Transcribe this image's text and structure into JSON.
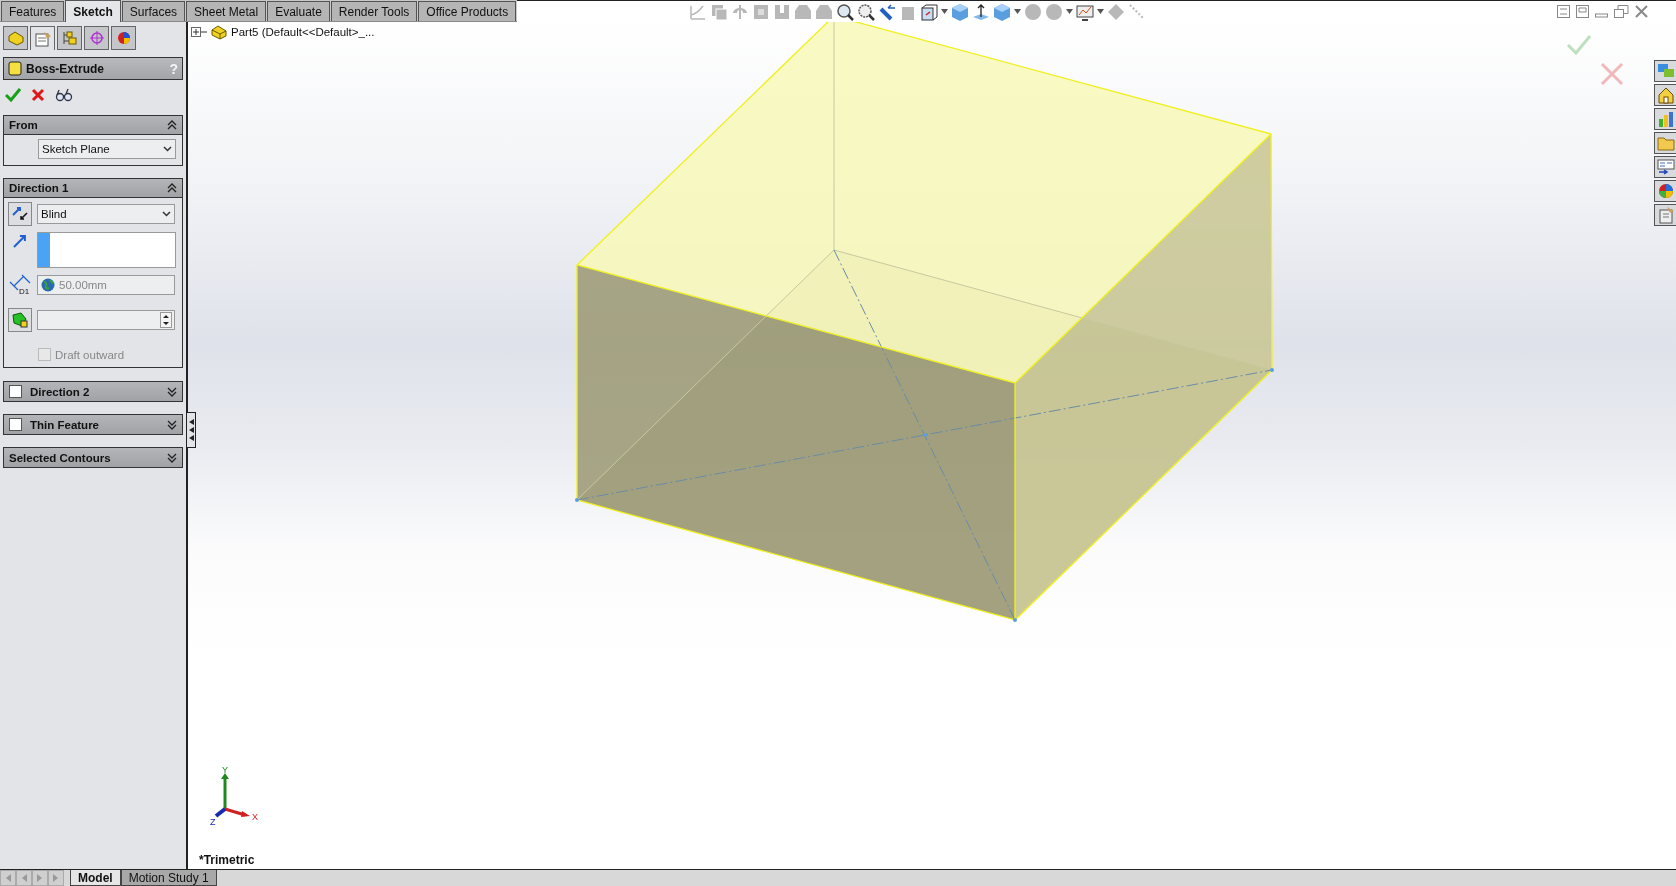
{
  "command_tabs": [
    {
      "label": "Features",
      "selected": false
    },
    {
      "label": "Sketch",
      "selected": true
    },
    {
      "label": "Surfaces",
      "selected": false
    },
    {
      "label": "Sheet Metal",
      "selected": false
    },
    {
      "label": "Evaluate",
      "selected": false
    },
    {
      "label": "Render Tools",
      "selected": false
    },
    {
      "label": "Office Products",
      "selected": false
    }
  ],
  "panel_tabs": [
    {
      "kind": "tree",
      "selected": false
    },
    {
      "kind": "property",
      "selected": true
    },
    {
      "kind": "config",
      "selected": false
    },
    {
      "kind": "dimxpert",
      "selected": false
    },
    {
      "kind": "display",
      "selected": false
    }
  ],
  "feature": {
    "title": "Boss-Extrude",
    "help": "?"
  },
  "from": {
    "title": "From",
    "expanded": true,
    "start": "Sketch Plane"
  },
  "direction1": {
    "title": "Direction 1",
    "expanded": true,
    "end_condition": "Blind",
    "depth": "50.00mm",
    "depth_symbol": "D1",
    "draft_outward": {
      "label": "Draft outward",
      "checked": false,
      "disabled": true
    }
  },
  "collapsed_groups": [
    {
      "title": "Direction 2",
      "kind": "checkbox",
      "checked": false,
      "expanded": false
    },
    {
      "title": "Thin Feature",
      "kind": "checkbox",
      "checked": false,
      "expanded": false
    },
    {
      "title": "Selected Contours",
      "kind": "plain",
      "expanded": false
    }
  ],
  "tree": {
    "root": "Part5  (Default<<Default>_..."
  },
  "axes": {
    "x": "X",
    "y": "Y",
    "z": "Z"
  },
  "view_name": "*Trimetric",
  "bottom_tabs": [
    {
      "label": "Model",
      "selected": true
    },
    {
      "label": "Motion Study 1",
      "selected": false
    }
  ]
}
